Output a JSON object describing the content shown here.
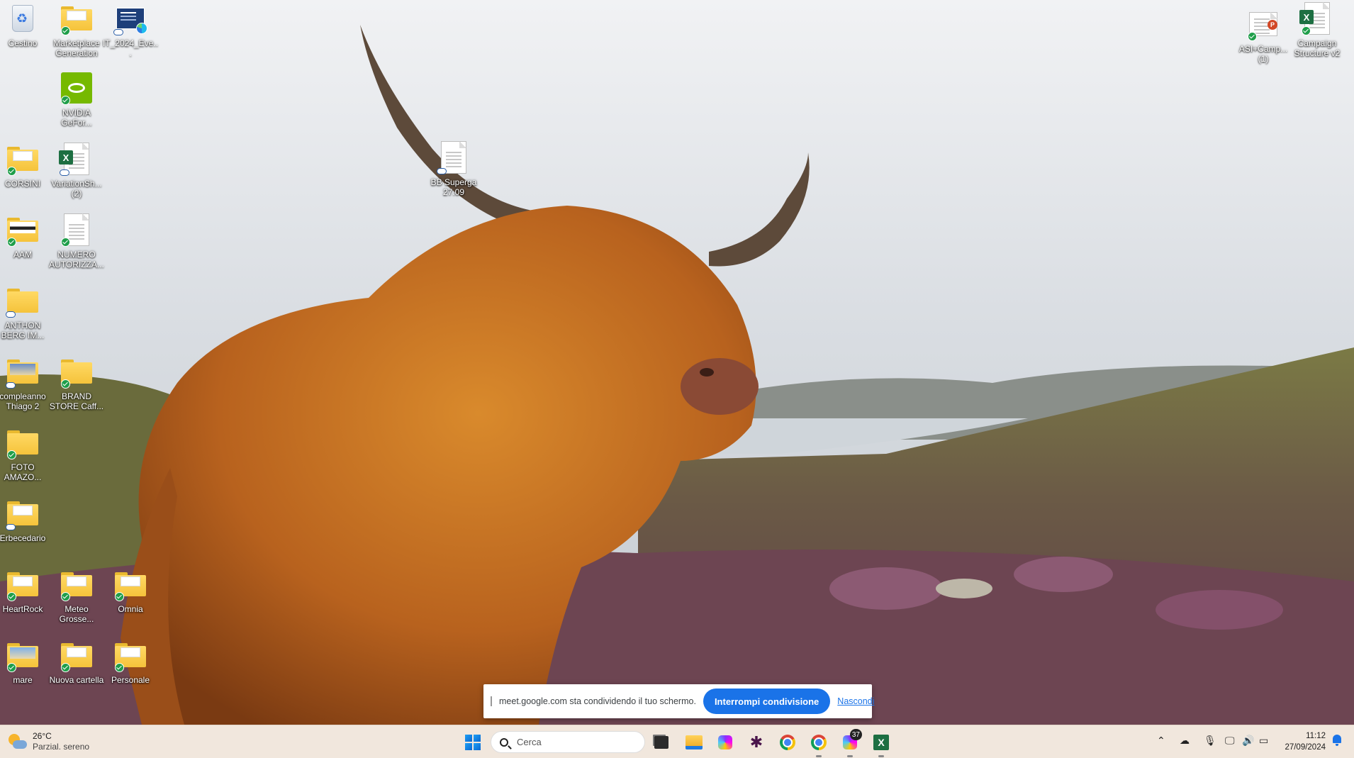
{
  "desktop": {
    "icons": [
      {
        "label": "Cestino",
        "kind": "recycle-bin"
      },
      {
        "label": "Marketplace Generation",
        "kind": "folder"
      },
      {
        "label": "IT_2024_Eve...",
        "kind": "slide"
      },
      {
        "label": "NVIDIA GeFor...",
        "kind": "nvidia"
      },
      {
        "label": "CORSINI",
        "kind": "folder"
      },
      {
        "label": "VariationSh... (2)",
        "kind": "excel-doc"
      },
      {
        "label": "AAM",
        "kind": "folder"
      },
      {
        "label": "NUMERO AUTORIZZA...",
        "kind": "doc"
      },
      {
        "label": "ANTHON BERG IM...",
        "kind": "folder"
      },
      {
        "label": "compleanno Thiago 2",
        "kind": "folder"
      },
      {
        "label": "BRAND STORE Caff...",
        "kind": "folder"
      },
      {
        "label": "FOTO AMAZO...",
        "kind": "folder"
      },
      {
        "label": "Erbecedario",
        "kind": "folder"
      },
      {
        "label": "HeartRock",
        "kind": "folder"
      },
      {
        "label": "Meteo Grosse...",
        "kind": "folder"
      },
      {
        "label": "Omnia",
        "kind": "folder"
      },
      {
        "label": "mare",
        "kind": "folder"
      },
      {
        "label": "Nuova cartella",
        "kind": "folder"
      },
      {
        "label": "Personale",
        "kind": "folder"
      },
      {
        "label": "BB Superga 27.09",
        "kind": "doc"
      },
      {
        "label": "ASI+Camp... (1)",
        "kind": "shortcut"
      },
      {
        "label": "Campaign Structure v2",
        "kind": "excel-doc"
      }
    ]
  },
  "sharebar": {
    "message": "meet.google.com sta condividendo il tuo schermo.",
    "stop_label": "Interrompi condivisione",
    "hide_label": "Nascondi"
  },
  "taskbar": {
    "weather": {
      "temp": "26°C",
      "condition": "Parzial. sereno"
    },
    "search_placeholder": "Cerca",
    "apps": [
      "windows-start-icon",
      "task-view-icon",
      "file-explorer-icon",
      "clickup-icon",
      "slack-icon",
      "chrome-icon",
      "chrome-profile-icon",
      "clickup-notifications-icon",
      "excel-icon"
    ],
    "clickup_badge": "37",
    "clock": {
      "time": "11:12",
      "date": "27/09/2024"
    }
  },
  "colors": {
    "accent": "#1a73e8",
    "taskbar": "#f1e7dd",
    "excel": "#1d6f42"
  }
}
